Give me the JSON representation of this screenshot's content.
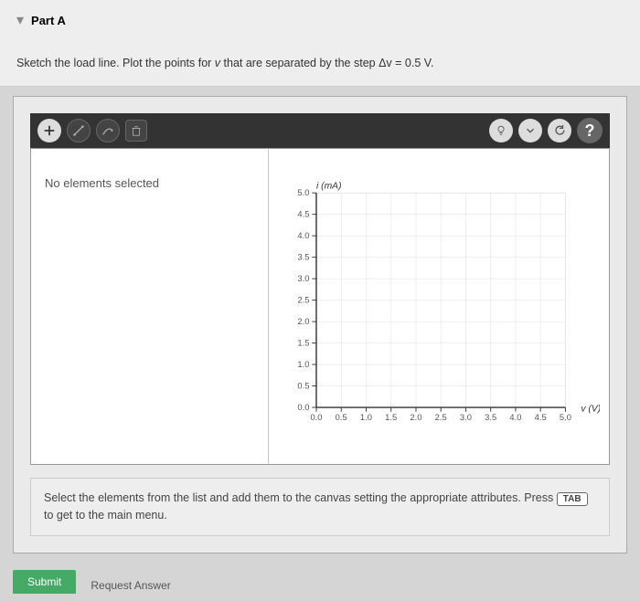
{
  "header": {
    "part_label": "Part A",
    "instruction_prefix": "Sketch the load line. Plot the points for ",
    "instruction_var1": "v",
    "instruction_mid": " that are separated by the step ",
    "instruction_delta": "Δv = 0.5 V",
    "instruction_suffix": "."
  },
  "sidebar": {
    "no_selection": "No elements selected"
  },
  "hint": {
    "text_before": "Select the elements from the list and add them to the canvas setting the appropriate attributes. Press ",
    "tab_label": "TAB",
    "text_after": " to get to the main menu."
  },
  "bottom": {
    "submit": "Submit",
    "request": "Request Answer"
  },
  "chart_data": {
    "type": "scatter",
    "title": "",
    "xlabel": "v (V)",
    "ylabel": "i (mA)",
    "x_ticks": [
      "0.0",
      "0.5",
      "1.0",
      "1.5",
      "2.0",
      "2.5",
      "3.0",
      "3.5",
      "4.0",
      "4.5",
      "5.0"
    ],
    "y_ticks": [
      "0.0",
      "0.5",
      "1.0",
      "1.5",
      "2.0",
      "2.5",
      "3.0",
      "3.5",
      "4.0",
      "4.5",
      "5.0"
    ],
    "xlim": [
      0,
      5
    ],
    "ylim": [
      0,
      5
    ],
    "series": []
  }
}
